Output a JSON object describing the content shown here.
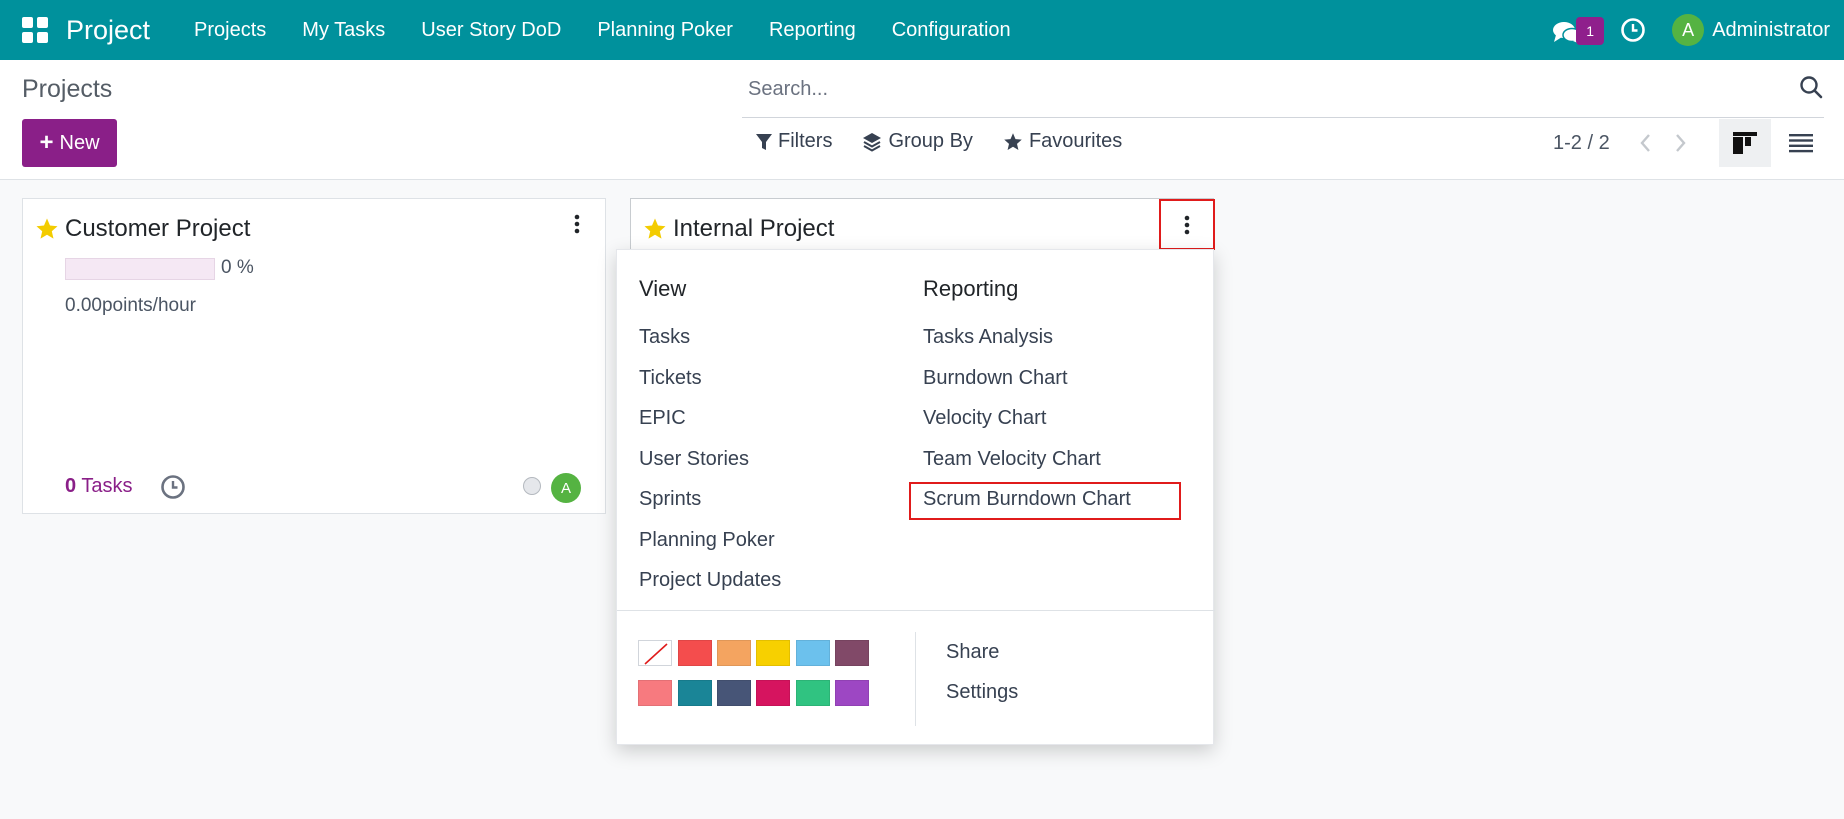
{
  "navbar": {
    "app_name": "Project",
    "menu": [
      "Projects",
      "My Tasks",
      "User Story DoD",
      "Planning Poker",
      "Reporting",
      "Configuration"
    ],
    "chat_badge": "1",
    "user_initial": "A",
    "user_name": "Administrator",
    "bg_color": "#00919c"
  },
  "control": {
    "title": "Projects",
    "new_label": "New",
    "search_placeholder": "Search...",
    "filters_label": "Filters",
    "group_by_label": "Group By",
    "favourites_label": "Favourites",
    "pager": "1-2 / 2"
  },
  "cards": [
    {
      "name": "Customer Project",
      "progress_percent": 0,
      "progress_label": "0 %",
      "rate": "0.00points/hour",
      "task_count": "0",
      "tasks_label": "Tasks",
      "avatar_initial": "A"
    },
    {
      "name": "Internal Project"
    }
  ],
  "dropdown": {
    "view_header": "View",
    "view_items": [
      "Tasks",
      "Tickets",
      "EPIC",
      "User Stories",
      "Sprints",
      "Planning Poker",
      "Project Updates"
    ],
    "reporting_header": "Reporting",
    "reporting_items": [
      "Tasks Analysis",
      "Burndown Chart",
      "Velocity Chart",
      "Team Velocity Chart",
      "Scrum Burndown Chart"
    ],
    "highlighted_item": "Scrum Burndown Chart",
    "colors_row1": [
      "none",
      "#f44d4d",
      "#f4a460",
      "#f7d000",
      "#6cc1ed",
      "#814968"
    ],
    "colors_row2": [
      "#f77a7f",
      "#1a8597",
      "#475577",
      "#d6145f",
      "#30c381",
      "#9d47c3"
    ],
    "share_label": "Share",
    "settings_label": "Settings"
  },
  "colors": {
    "accent": "#8a1f88",
    "highlight_border": "#e01b1b",
    "star": "#f3cc00"
  }
}
